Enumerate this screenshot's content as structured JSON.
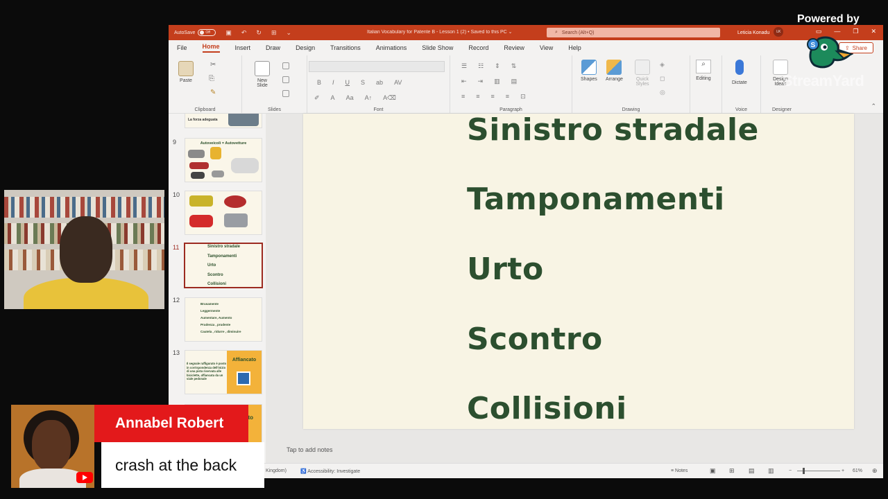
{
  "overlay": {
    "powered_by": "Powered by",
    "brand": "StreamYard",
    "presenter_name": "Annabel Robert",
    "comment": "crash at the back"
  },
  "window": {
    "autosave_label": "AutoSave",
    "autosave_state": "Off",
    "doc_title": "Italian Vocabulary for Patente B - Lesson 1 (2) • Saved to this PC ⌄",
    "search_placeholder": "Search (Alt+Q)",
    "user_name": "Leticia Konadu",
    "user_initials": "LK",
    "accent": "#c43e1c"
  },
  "menu": {
    "items": [
      "File",
      "Home",
      "Insert",
      "Draw",
      "Design",
      "Transitions",
      "Animations",
      "Slide Show",
      "Record",
      "Review",
      "View",
      "Help"
    ],
    "active": "Home",
    "share": "Share"
  },
  "ribbon": {
    "groups": {
      "clipboard": "Clipboard",
      "slides": "Slides",
      "font": "Font",
      "paragraph": "Paragraph",
      "drawing": "Drawing",
      "voice": "Voice",
      "designer": "Designer"
    },
    "buttons": {
      "paste": "Paste",
      "new_slide": "New Slide",
      "shapes": "Shapes",
      "arrange": "Arrange",
      "quick_styles": "Quick Styles",
      "editing": "Editing",
      "dictate": "Dictate",
      "design_ideas": "Design Ideas"
    }
  },
  "thumbnails": {
    "numbers": [
      "9",
      "10",
      "11",
      "12",
      "13"
    ],
    "slide8_caption": "La forza adeguata",
    "slide9_title": "Autoveicoli = Autovetture",
    "slide11_lines": [
      "Sinistro stradale",
      "Tamponamenti",
      "Urto",
      "Scontro",
      "Collisioni"
    ],
    "slide12_lines": [
      "Brusamente",
      "Leggermente",
      "Aumentare, Aumento",
      "Prudenza , prudente",
      "Cautela , ridurre , diminuire"
    ],
    "slide13_text": "Il segnale raffigurato è posto in corrispondenza dell'inizio di una pista riservata alle biciclette, affiancata da un viale pedonale",
    "slide13_label": "Affiancato",
    "slide14_partial": "ato"
  },
  "slide": {
    "words": [
      "Sinistro stradale",
      "Tamponamenti",
      "Urto",
      "Scontro",
      "Collisioni"
    ]
  },
  "notes_placeholder": "Tap to add notes",
  "status": {
    "language": "Kingdom)",
    "accessibility": "Accessibility: Investigate",
    "notes": "Notes",
    "zoom": "61%"
  }
}
